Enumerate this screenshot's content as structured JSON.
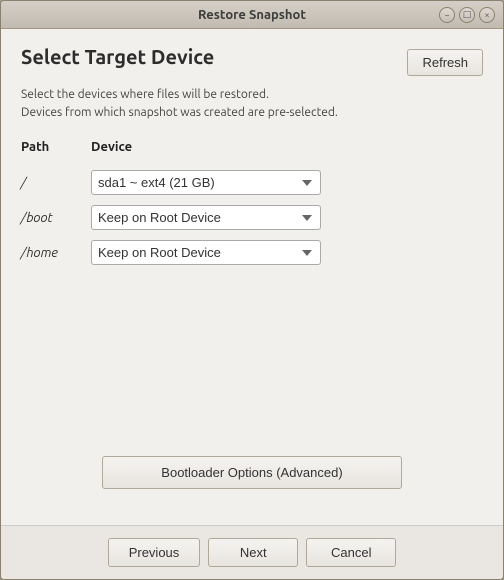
{
  "window": {
    "title": "Restore Snapshot",
    "controls": {
      "minimize": "−",
      "maximize": "□",
      "close": "×"
    }
  },
  "header": {
    "title": "Select Target Device",
    "refresh_label": "Refresh"
  },
  "description": {
    "line1": "Select the devices where files will be restored.",
    "line2": "Devices from which snapshot was created are pre-selected."
  },
  "table": {
    "col_path": "Path",
    "col_device": "Device",
    "rows": [
      {
        "path": "/",
        "device_value": "sda1 ~ ext4 (21 GB)",
        "options": [
          "sda1 ~ ext4 (21 GB)"
        ]
      },
      {
        "path": "/boot",
        "device_value": "Keep on Root Device",
        "options": [
          "Keep on Root Device"
        ]
      },
      {
        "path": "/home",
        "device_value": "Keep on Root Device",
        "options": [
          "Keep on Root Device"
        ]
      }
    ]
  },
  "bootloader": {
    "label": "Bootloader Options (Advanced)"
  },
  "nav": {
    "previous_label": "Previous",
    "next_label": "Next",
    "cancel_label": "Cancel"
  }
}
